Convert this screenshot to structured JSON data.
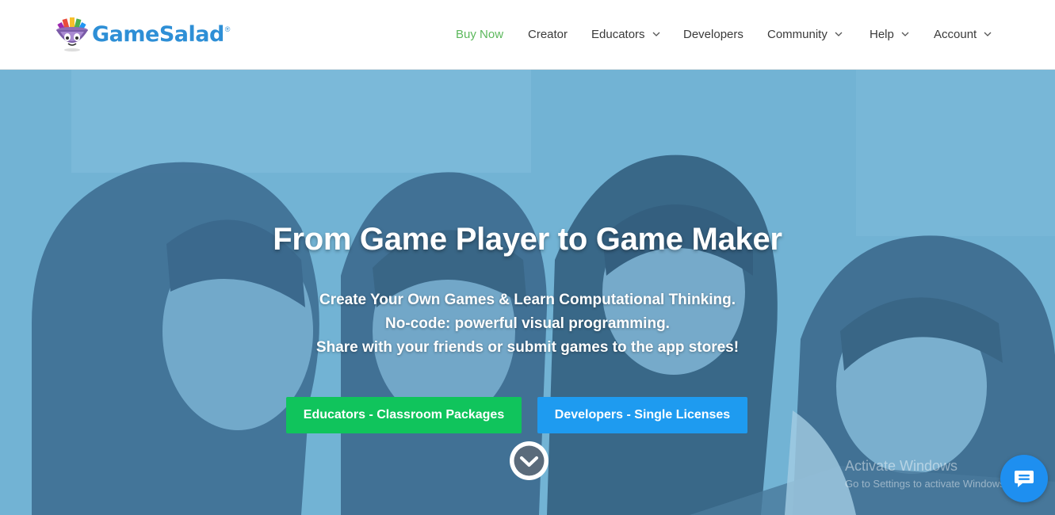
{
  "brand": {
    "name": "GameSalad",
    "reg": "®"
  },
  "nav": {
    "items": [
      {
        "label": "Buy Now",
        "active": true,
        "dropdown": false
      },
      {
        "label": "Creator",
        "active": false,
        "dropdown": false
      },
      {
        "label": "Educators",
        "active": false,
        "dropdown": true
      },
      {
        "label": "Developers",
        "active": false,
        "dropdown": false
      },
      {
        "label": "Community",
        "active": false,
        "dropdown": true
      },
      {
        "label": "Help",
        "active": false,
        "dropdown": true
      },
      {
        "label": "Account",
        "active": false,
        "dropdown": true
      }
    ]
  },
  "hero": {
    "title": "From Game Player to Game Maker",
    "lines": [
      "Create Your Own Games & Learn Computational Thinking.",
      "No-code: powerful visual programming.",
      "Share with your friends or submit games to the app stores!"
    ],
    "cta_primary": "Educators - Classroom Packages",
    "cta_secondary": "Developers - Single Licenses"
  },
  "watermark": {
    "title": "Activate Windows",
    "subtitle": "Go to Settings to activate Windows."
  },
  "colors": {
    "brand_blue": "#2e8fd6",
    "nav_active": "#5cb85c",
    "cta_green": "#10c45c",
    "cta_blue": "#1e9bf0",
    "chat_blue": "#1e8ff0"
  },
  "icons": {
    "scroll_down": "chevron-down-icon",
    "chat": "chat-icon",
    "nav_dropdown": "chevron-down-icon"
  }
}
